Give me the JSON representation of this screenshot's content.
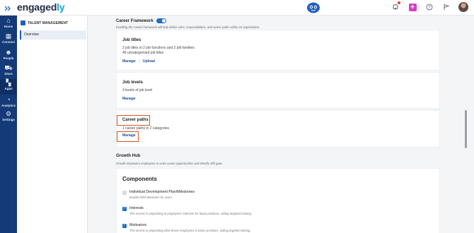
{
  "app": {
    "logo_main": "engaged",
    "logo_accent": "ly"
  },
  "colors": {
    "nav_bg": "#143a78",
    "accent": "#1f6ec9",
    "link": "#1f4e9a",
    "highlight": "#d9531e",
    "plus_button": "#d63ec8"
  },
  "topbar": {
    "icons": [
      "hamburger-icon",
      "mascot-icon",
      "bell-icon",
      "plus-icon",
      "help-icon",
      "flag-icon",
      "avatar"
    ]
  },
  "leftnav": {
    "items": [
      {
        "label": "Home",
        "icon": "⌂"
      },
      {
        "label": "Connect",
        "icon": "▦"
      },
      {
        "label": "People",
        "icon": "☻"
      },
      {
        "label": "Store",
        "icon": "⛟"
      },
      {
        "label": "Apps",
        "icon": "▚"
      },
      {
        "label": "Analytics",
        "icon": "◔"
      },
      {
        "label": "Settings",
        "icon": "⚙"
      }
    ]
  },
  "subnav": {
    "heading": "TALENT MANAGEMENT",
    "item": "Overview"
  },
  "career_framework": {
    "title": "Career Framework",
    "enabled": true,
    "description": "Enabling the Career framework will help define roles, responsibilities, and career paths within an organization."
  },
  "job_titles": {
    "title": "Job titles",
    "line1": "2 job titles in 2 job functions and 2 job families",
    "line2": "49 uncategorised job titles",
    "manage": "Manage",
    "separator": "|",
    "upload": "Upload"
  },
  "job_levels": {
    "title": "Job levels",
    "line1": "3 levels of job level",
    "manage": "Manage"
  },
  "career_paths": {
    "title": "Career paths",
    "line1": "1 career paths in 2 categories",
    "manage": "Manage"
  },
  "growth_hub": {
    "title": "Growth Hub",
    "description": "Growth empowers employees to seize career opportunities and identify skill gaps."
  },
  "components": {
    "title": "Components",
    "items": [
      {
        "name": "Individual Development Plan/Milestones",
        "desc": "Enable IDP/milestones for users.",
        "checked": false
      },
      {
        "name": "Interests",
        "desc": "This assists in pinpointing in employees' interests for future positions, aiding targeted training.",
        "checked": true
      },
      {
        "name": "Motivators",
        "desc": "This assists in pinpointing what drives employees in future positions, aiding targeted training.",
        "checked": true
      }
    ]
  }
}
